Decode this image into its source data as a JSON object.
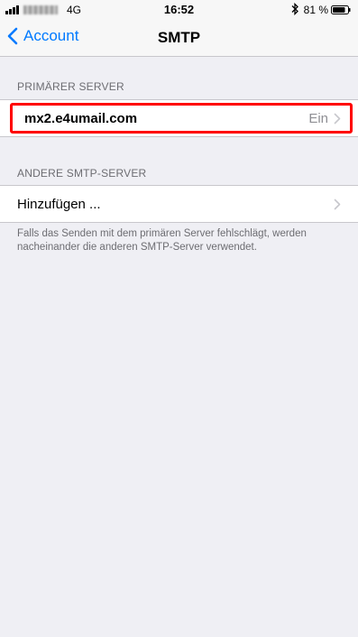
{
  "status_bar": {
    "network": "4G",
    "time": "16:52",
    "battery": "81 %"
  },
  "navbar": {
    "back_label": "Account",
    "title": "SMTP"
  },
  "primary_section": {
    "header": "PRIMÄRER SERVER",
    "server_name": "mx2.e4umail.com",
    "server_status": "Ein"
  },
  "other_section": {
    "header": "ANDERE SMTP-SERVER",
    "add_label": "Hinzufügen ...",
    "footer": "Falls das Senden mit dem primären Server fehlschlägt, werden nacheinander die anderen SMTP-Server verwendet."
  },
  "colors": {
    "accent": "#007aff",
    "highlight": "#ff0000",
    "background": "#efeff4"
  }
}
